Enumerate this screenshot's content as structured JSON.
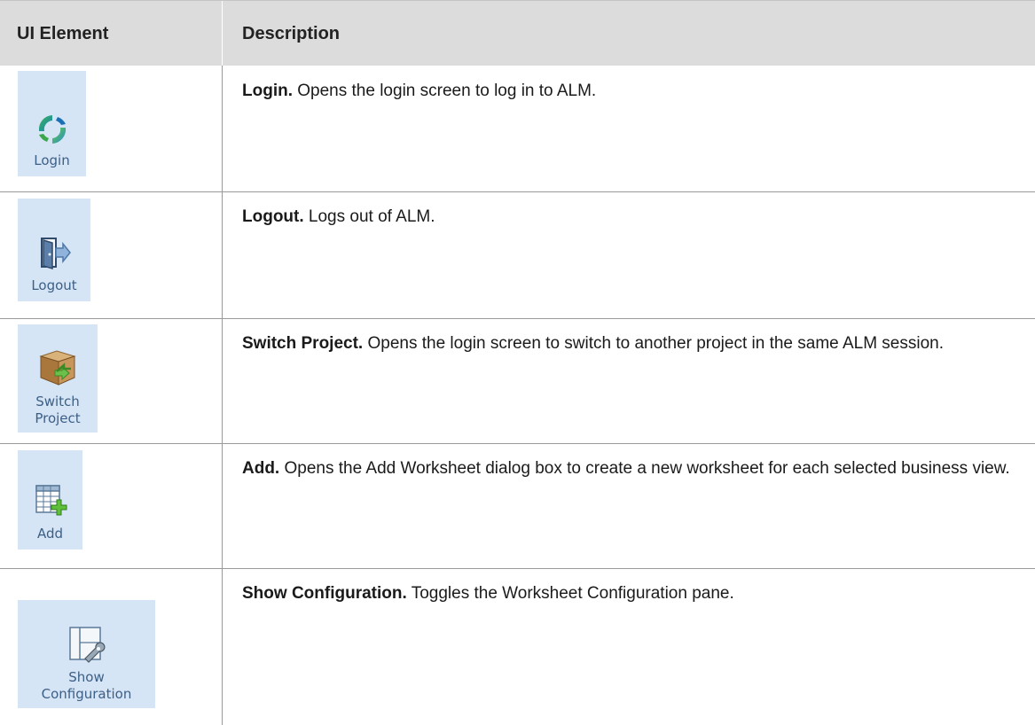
{
  "table": {
    "headers": [
      "UI Element",
      "Description"
    ],
    "rows": [
      {
        "icon": "login-icon",
        "caption": "Login",
        "term": "Login.",
        "description": "Opens the login screen to log in to ALM."
      },
      {
        "icon": "logout-icon",
        "caption": "Logout",
        "term": "Logout.",
        "description": "Logs out of ALM."
      },
      {
        "icon": "switch-project-icon",
        "caption_lines": [
          "Switch",
          "Project"
        ],
        "term": "Switch Project.",
        "description": "Opens the login screen to switch to another project in the same ALM session."
      },
      {
        "icon": "add-worksheet-icon",
        "caption": "Add",
        "term": "Add.",
        "description": "Opens the Add Worksheet dialog box to create a new worksheet for each selected business view."
      },
      {
        "icon": "show-configuration-icon",
        "caption_lines": [
          "Show",
          "Configuration"
        ],
        "term": "Show Configuration.",
        "description": "Toggles the Worksheet Configuration pane."
      }
    ]
  },
  "colors": {
    "header_bg": "#dcdcdc",
    "icon_tile_bg": "#d6e5f5",
    "caption_text": "#3c5f86",
    "grid_line": "#9a9a9a"
  }
}
